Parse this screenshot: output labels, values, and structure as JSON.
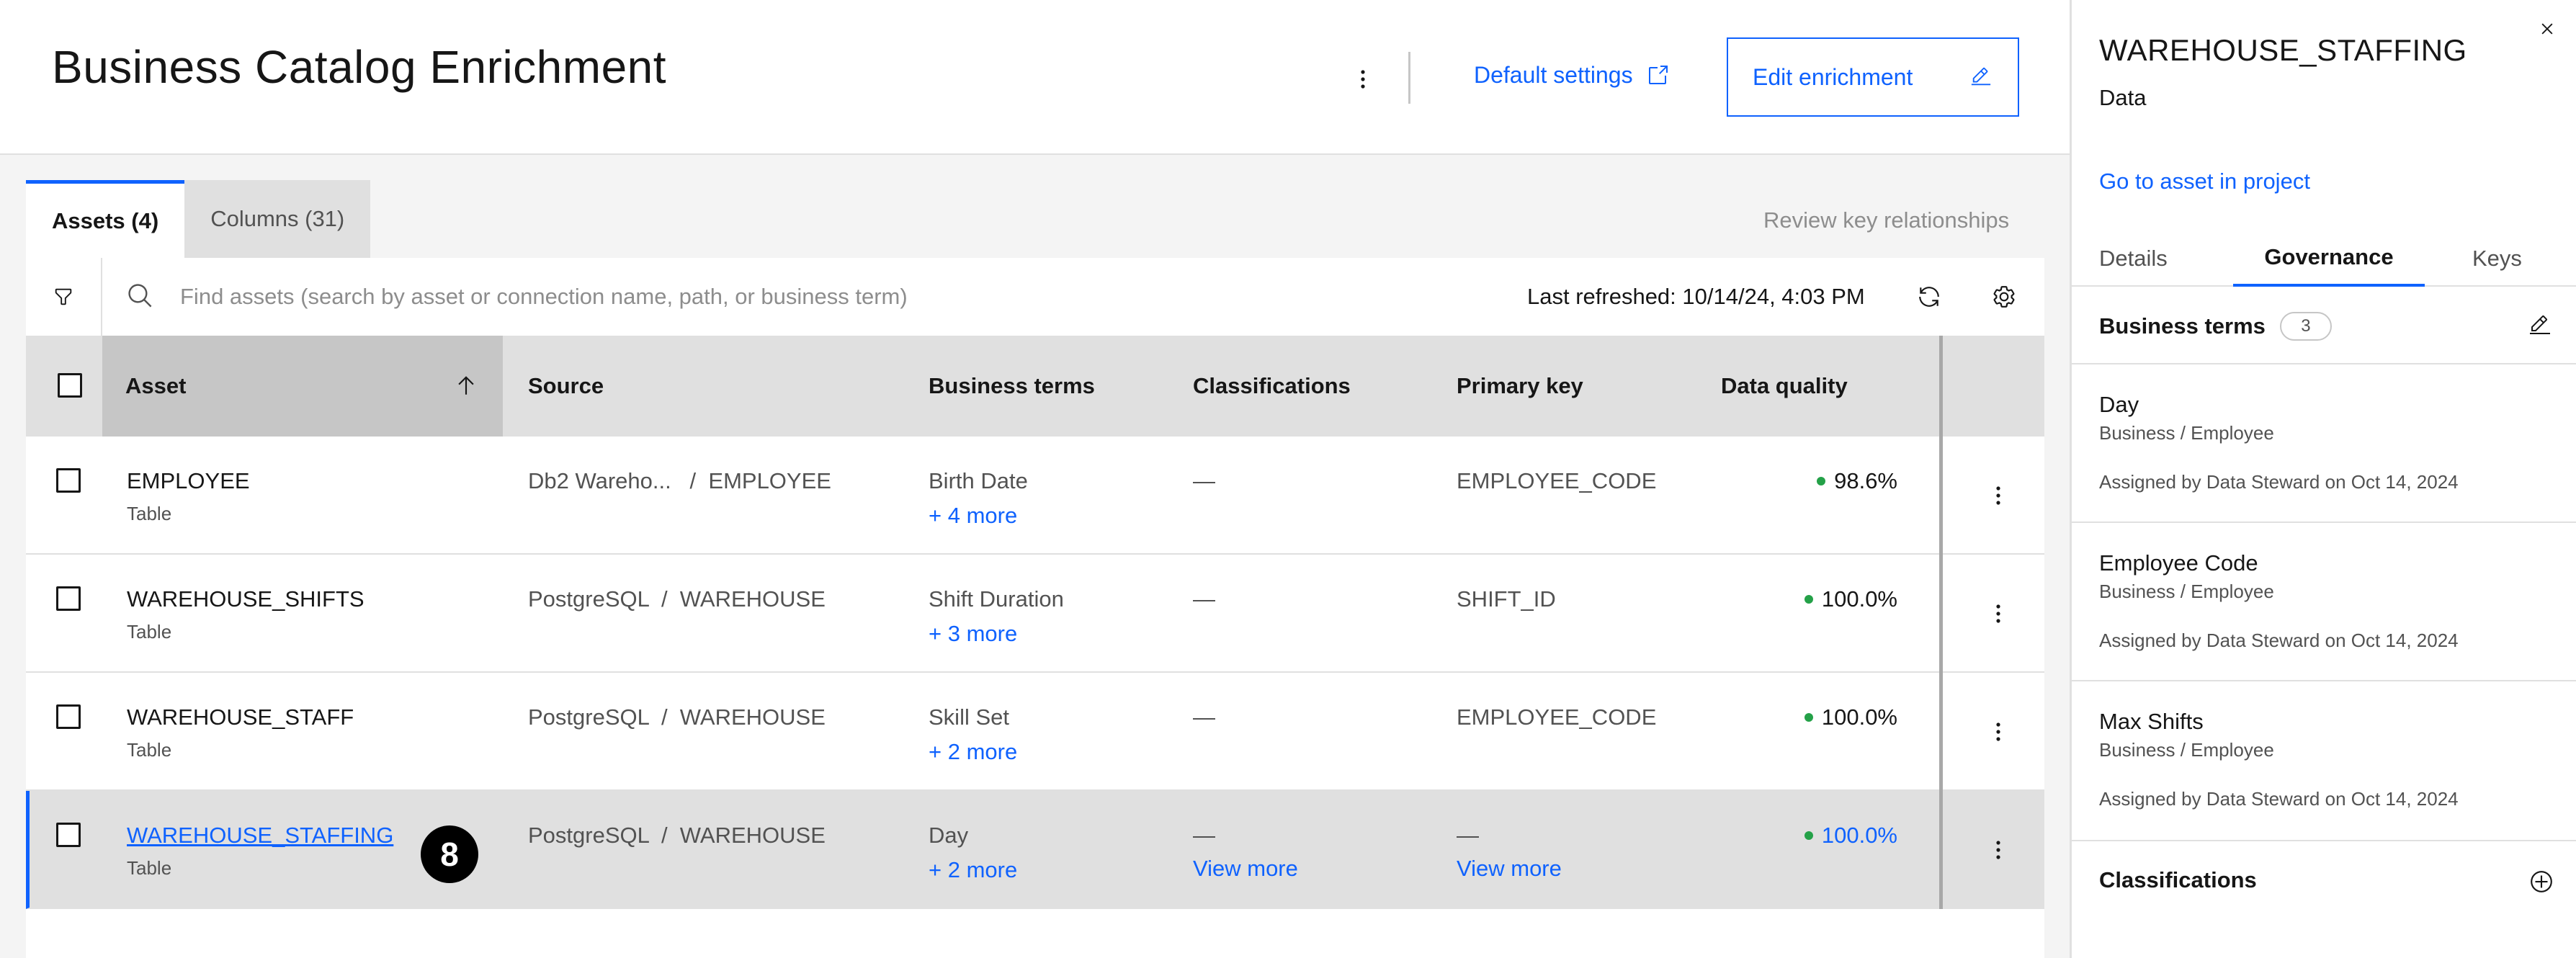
{
  "header": {
    "title": "Business Catalog Enrichment",
    "default_settings_label": "Default settings",
    "edit_enrichment_label": "Edit enrichment"
  },
  "tabs": [
    {
      "label": "Assets (4)",
      "active": true
    },
    {
      "label": "Columns (31)",
      "active": false
    }
  ],
  "review_key_relationships": "Review key relationships",
  "toolbar": {
    "search_placeholder": "Find assets (search by asset or connection name, path, or business term)",
    "last_refreshed": "Last refreshed: 10/14/24, 4:03 PM"
  },
  "table": {
    "columns": [
      "Asset",
      "Source",
      "Business terms",
      "Classifications",
      "Primary key",
      "Data quality"
    ],
    "rows": [
      {
        "name": "EMPLOYEE",
        "type": "Table",
        "source": "Db2 Wareho...   /  EMPLOYEE",
        "term": "Birth Date",
        "more_terms": "+ 4 more",
        "classification": "—",
        "primary_key": "EMPLOYEE_CODE",
        "data_quality": "98.6%"
      },
      {
        "name": "WAREHOUSE_SHIFTS",
        "type": "Table",
        "source": "PostgreSQL  /  WAREHOUSE",
        "term": "Shift Duration",
        "more_terms": "+ 3 more",
        "classification": "—",
        "primary_key": "SHIFT_ID",
        "data_quality": "100.0%"
      },
      {
        "name": "WAREHOUSE_STAFF",
        "type": "Table",
        "source": "PostgreSQL  /  WAREHOUSE",
        "term": "Skill Set",
        "more_terms": "+ 2 more",
        "classification": "—",
        "primary_key": "EMPLOYEE_CODE",
        "data_quality": "100.0%"
      },
      {
        "name": "WAREHOUSE_STAFFING",
        "type": "Table",
        "source": "PostgreSQL  /  WAREHOUSE",
        "term": "Day",
        "more_terms": "+ 2 more",
        "classification": "—",
        "classification_more": "View more",
        "primary_key": "—",
        "primary_key_more": "View more",
        "data_quality": "100.0%",
        "step_badge": "8"
      }
    ]
  },
  "side_panel": {
    "title": "WAREHOUSE_STAFFING",
    "subtitle": "Data",
    "link": "Go to asset in project",
    "tabs": [
      "Details",
      "Governance",
      "Keys"
    ],
    "business_terms_title": "Business terms",
    "business_terms_count": "3",
    "terms": [
      {
        "name": "Day",
        "path": "Business / Employee",
        "assigned": "Assigned by Data Steward on Oct 14, 2024"
      },
      {
        "name": "Employee Code",
        "path": "Business / Employee",
        "assigned": "Assigned by Data Steward on Oct 14, 2024"
      },
      {
        "name": "Max Shifts",
        "path": "Business / Employee",
        "assigned": "Assigned by Data Steward on Oct 14, 2024"
      }
    ],
    "classifications_title": "Classifications"
  },
  "colors": {
    "accent": "#0f62fe",
    "status_green": "#24a148",
    "badge": "#000000"
  },
  "icons": [
    "overflow-menu-icon",
    "launch-icon",
    "edit-icon",
    "filter-icon",
    "search-icon",
    "refresh-icon",
    "settings-icon",
    "arrow-up-icon",
    "close-icon",
    "add-circle-icon"
  ]
}
